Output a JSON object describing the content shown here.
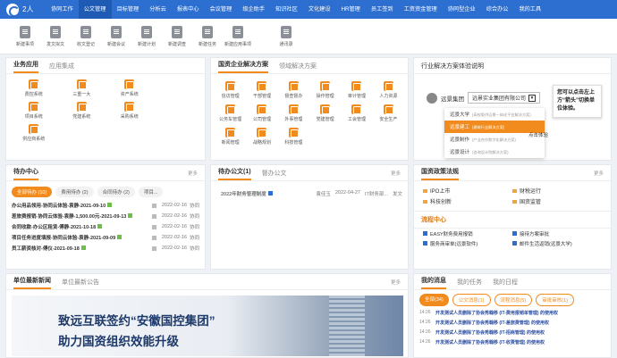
{
  "topbar": {
    "logo_text": "致远",
    "user": "2人",
    "items": [
      "协同工作",
      "公文管理",
      "目标管理",
      "分析云",
      "报表中心",
      "会议管理",
      "级企助手",
      "知识社区",
      "文化建设",
      "HR管理",
      "员工签到",
      "工资资金管理",
      "协同型企业",
      "综合办公",
      "我的工具"
    ],
    "active_index": 1
  },
  "toolbar": {
    "items": [
      "新建事项",
      "发文拟文",
      "收文登记",
      "新建会议",
      "新建计划",
      "新建调查",
      "新建任务",
      "新建应用事项",
      "通讯录"
    ]
  },
  "business": {
    "tabs": [
      "业务应用",
      "应用集成"
    ],
    "items": [
      "费控系统",
      "三重一大",
      "资产系统",
      "项目系统",
      "党建系统",
      "采购系统",
      "供应商系统"
    ]
  },
  "solutions": {
    "tabs": [
      "国资企业解决方案",
      "领域解决方案"
    ],
    "items": [
      "信访管理",
      "干部管理",
      "督查督办",
      "操作管理",
      "审计管理",
      "人力资源",
      "公务车管理",
      "公司管理",
      "外事管理",
      "党建管理",
      "工会管理",
      "安全生产",
      "新闻管理",
      "战略规划",
      "科技管理"
    ]
  },
  "hint": {
    "title": "行业解决方案体验说明",
    "company_logo_text": "远景集团",
    "company_name": "远景实业集团有限公司",
    "options": [
      {
        "name": "远景大学",
        "note": "(高校版供远景一体化平台解决方案)"
      },
      {
        "name": "远景建工",
        "note": "(建筑行业解决方案)"
      },
      {
        "name": "远景制作",
        "note": "(产业合作数字化解决方案)"
      },
      {
        "name": "远景设计",
        "note": "(咨询设计院解决方案)"
      }
    ],
    "selected_index": 1,
    "callout": "您可以点击左上方“箭头”切换单位体验。",
    "click_hint": "点击体验"
  },
  "todo": {
    "title": "待办中心",
    "more": "更多",
    "pills": [
      "全部待办 (10)",
      "费用待办 (2)",
      "合同待办 (2)",
      "项目..."
    ],
    "rows": [
      {
        "title": "办公用品领用-协同云体验-袁静-2021-09-10",
        "date": "2022-02-16",
        "user": "协同"
      },
      {
        "title": "差旅费报销-协同云体验-袁静-1,500.00元-2021-09-13",
        "date": "2022-02-16",
        "user": "协同"
      },
      {
        "title": "合同收款-办公区租赁-傅静-2021-10-18",
        "date": "2022-02-16",
        "user": "协同"
      },
      {
        "title": "项目任务进度填报-协同云体验-袁静-2021-09-09",
        "date": "2022-02-16",
        "user": "协同"
      },
      {
        "title": "员工薪资核对-傅仪-2021-09-18",
        "date": "2022-02-16",
        "user": "协同"
      }
    ]
  },
  "docs": {
    "tabs": [
      "待办公文(1)",
      "督办公文"
    ],
    "more": "更多",
    "rows": [
      {
        "title": "2022年财务管理制度",
        "user": "袁佳玉",
        "date": "2022-04-27",
        "dept": "IT财务部...",
        "type": "发文"
      }
    ]
  },
  "policy": {
    "title": "国资政策法规",
    "more": "更多",
    "items": [
      "IPO上市",
      "财税运行",
      "科技创新",
      "国资监管"
    ]
  },
  "flow": {
    "title": "流程中心",
    "items": [
      "EASY财务费用报销",
      "接待方案审批",
      "服务商审单(远景软件)",
      "邮件生活返销(远景大学)"
    ]
  },
  "news": {
    "tabs": [
      "单位最新新闻",
      "单位最新公告"
    ],
    "more": "更多",
    "banner_line1": "致远互联签约“安徽国控集团”",
    "banner_line2": "助力国资组织效能升级"
  },
  "messages": {
    "tabs": [
      "我的消息",
      "我的任务",
      "我的日程"
    ],
    "pills": [
      "全部(34)",
      "公文消息(1)",
      "流程消息(5)",
      "审批审核(1)"
    ],
    "rows": [
      {
        "time": "14:26",
        "text": "开发测试人员删除了协会秀翰移 (IT-费用报销单管理) 的使用权"
      },
      {
        "time": "14:26",
        "text": "开发测试人员删除了协会秀翰移 (IT-差旅费管理) 的使用权"
      },
      {
        "time": "14:26",
        "text": "开发测试人员删除了协会秀翰移 (IT-招商管理) 的使用权"
      },
      {
        "time": "14:26",
        "text": "开发测试人员删除了协会秀翰移 (IT-收费管理) 的使用权"
      }
    ]
  }
}
